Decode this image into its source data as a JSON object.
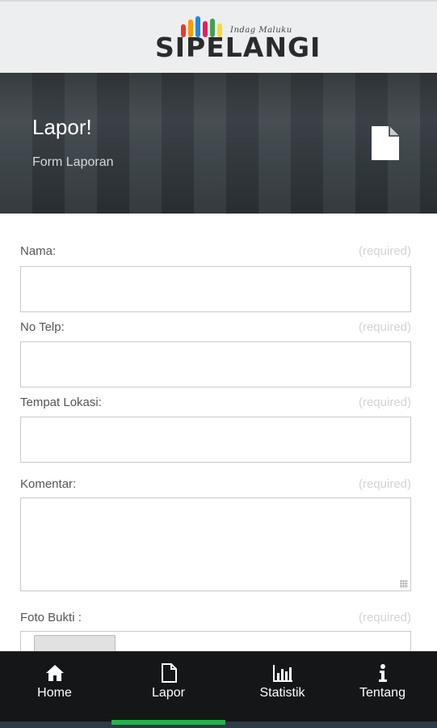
{
  "header": {
    "logo_text": "SIPELANGI",
    "logo_tagline": "Indag Maluku",
    "logo_bar_colors": [
      "#e53935",
      "#ff9800",
      "#1e88e5",
      "#e91e63",
      "#43a047",
      "#fdd835"
    ]
  },
  "banner": {
    "title": "Lapor!",
    "subtitle": "Form Laporan",
    "icon": "document-icon"
  },
  "form": {
    "required_text": "(required)",
    "fields": [
      {
        "label": "Nama:",
        "value": "",
        "placeholder": ""
      },
      {
        "label": "No Telp:",
        "value": "",
        "placeholder": ""
      },
      {
        "label": "Tempat Lokasi:",
        "value": "",
        "placeholder": ""
      },
      {
        "label": "Komentar:",
        "value": "",
        "placeholder": ""
      },
      {
        "label": "Foto Bukti :",
        "value": "",
        "placeholder": ""
      }
    ]
  },
  "bottom_nav": {
    "active_index": 1,
    "active_color": "#25b34a",
    "items": [
      {
        "label": "Home",
        "icon": "home-icon"
      },
      {
        "label": "Lapor",
        "icon": "document-icon"
      },
      {
        "label": "Statistik",
        "icon": "bar-chart-icon"
      },
      {
        "label": "Tentang",
        "icon": "info-icon"
      }
    ]
  }
}
